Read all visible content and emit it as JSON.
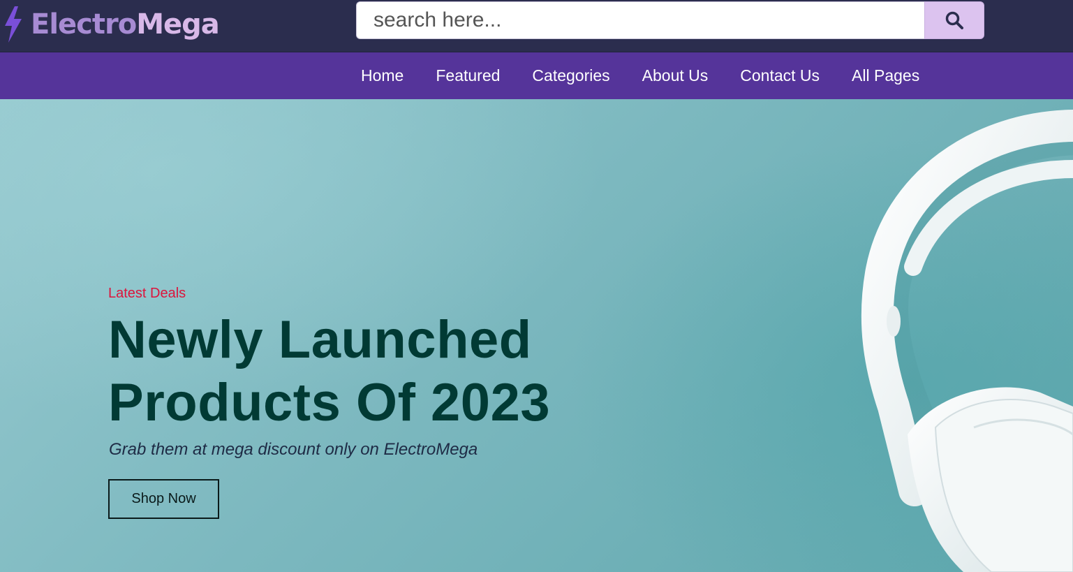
{
  "header": {
    "logo_part1": "Electro",
    "logo_part2": "Mega",
    "search_placeholder": "search here...",
    "search_icon": "magnifier-icon",
    "logo_icon": "lightning-bolt-icon"
  },
  "nav": {
    "items": [
      {
        "label": "Home"
      },
      {
        "label": "Featured"
      },
      {
        "label": "Categories"
      },
      {
        "label": "About Us"
      },
      {
        "label": "Contact Us"
      },
      {
        "label": "All Pages"
      }
    ]
  },
  "hero": {
    "eyebrow": "Latest Deals",
    "headline_line1": "Newly Launched",
    "headline_line2": "Products Of 2023",
    "subline": "Grab them at mega discount only on ElectroMega",
    "cta_label": "Shop Now",
    "image": "white-headphones"
  },
  "colors": {
    "header_bg": "#2b2d4e",
    "nav_bg": "#55349a",
    "eyebrow": "#dc143c",
    "headline": "#013a34",
    "search_button": "#dcc3ef"
  }
}
